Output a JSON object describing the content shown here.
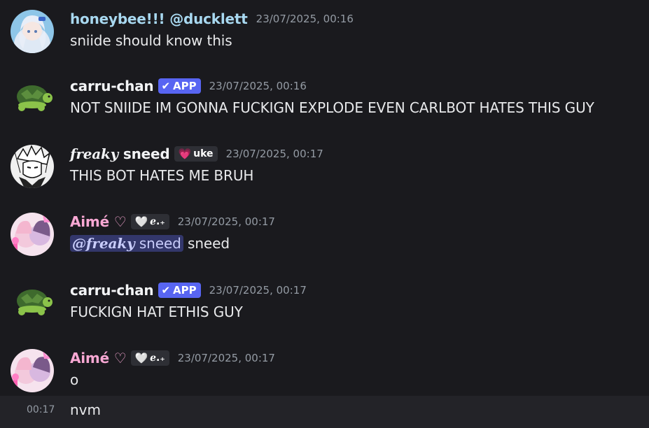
{
  "messages": [
    {
      "author": "honeybee!!! @ducklett",
      "timestamp": "23/07/2025, 00:16",
      "content": "sniide should know this",
      "name_color": "#a8d8f0"
    },
    {
      "author": "carru-chan",
      "badge": "APP",
      "timestamp": "23/07/2025, 00:16",
      "content": "NOT SNIIDE IM GONNA FUCKIGN EXPLODE EVEN CARLBOT HATES THIS GUY",
      "name_color": "#f2f3f5"
    },
    {
      "author_fancy": "𝒇𝒓𝒆𝒂𝒌𝒚",
      "author_rest": "sneed",
      "tag": "uke",
      "timestamp": "23/07/2025, 00:17",
      "content": "THIS BOT HATES ME BRUH",
      "name_color": "#f2f3f5"
    },
    {
      "author": "Aimé ♡",
      "tag": "ℯ.₊",
      "timestamp": "23/07/2025, 00:17",
      "mention_fancy": "@𝒇𝒓𝒆𝒂𝒌𝒚",
      "mention_rest": " sneed",
      "content_after": " sneed",
      "name_color": "#f9a8d4"
    },
    {
      "author": "carru-chan",
      "badge": "APP",
      "timestamp": "23/07/2025, 00:17",
      "content": "FUCKIGN HAT ETHIS GUY",
      "name_color": "#f2f3f5"
    },
    {
      "author": "Aimé ♡",
      "tag": "ℯ.₊",
      "timestamp": "23/07/2025, 00:17",
      "content": "o",
      "name_color": "#f9a8d4"
    }
  ],
  "followup": {
    "timestamp": "00:17",
    "content": "nvm"
  },
  "icons": {
    "app_check": "✔",
    "heart_pink": "💗",
    "heart_white": "🤍"
  }
}
